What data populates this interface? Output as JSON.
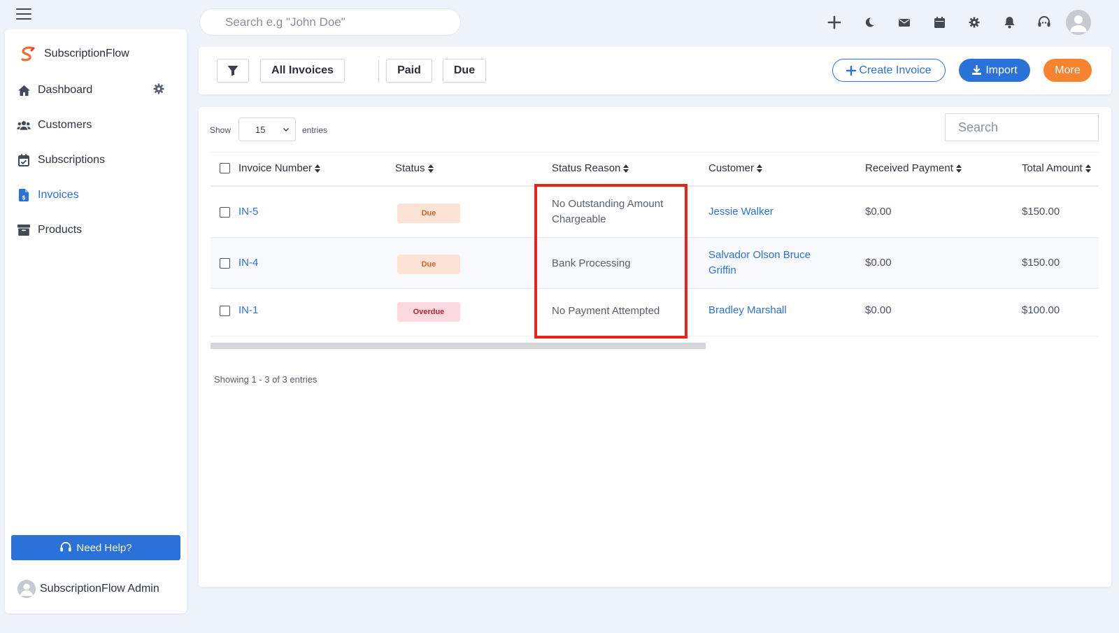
{
  "brand": {
    "name": "SubscriptionFlow"
  },
  "sidebar": {
    "items": [
      {
        "label": "Dashboard",
        "icon": "home-icon",
        "active": false
      },
      {
        "label": "Customers",
        "icon": "users-icon",
        "active": false
      },
      {
        "label": "Subscriptions",
        "icon": "calendar-check-icon",
        "active": false
      },
      {
        "label": "Invoices",
        "icon": "invoice-icon",
        "active": true
      },
      {
        "label": "Products",
        "icon": "archive-icon",
        "active": false
      }
    ],
    "help_label": "Need Help?",
    "admin_name": "SubscriptionFlow Admin"
  },
  "topbar": {
    "search_placeholder": "Search e.g \"John Doe\"",
    "icons": [
      "plus-icon",
      "moon-icon",
      "mail-icon",
      "calendar-icon",
      "gear-icon",
      "bell-icon",
      "headset-icon"
    ]
  },
  "toolbar": {
    "all_invoices": "All Invoices",
    "paid": "Paid",
    "due": "Due",
    "create_invoice": "Create Invoice",
    "import": "Import",
    "more": "More"
  },
  "table_controls": {
    "show_label": "Show",
    "entries_value": "15",
    "entries_label": "entries",
    "search_placeholder": "Search"
  },
  "table": {
    "columns": [
      "Invoice Number",
      "Status",
      "Status Reason",
      "Customer",
      "Received Payment",
      "Total Amount"
    ],
    "rows": [
      {
        "invoice": "IN-5",
        "status": "Due",
        "reason_line1": "No Outstanding Amount",
        "reason_line2": "Chargeable",
        "customer_line1": "Jessie Walker",
        "customer_line2": "",
        "received": "$0.00",
        "total": "$150.00"
      },
      {
        "invoice": "IN-4",
        "status": "Due",
        "reason_line1": "Bank Processing",
        "reason_line2": "",
        "customer_line1": "Salvador Olson Bruce",
        "customer_line2": "Griffin",
        "received": "$0.00",
        "total": "$150.00"
      },
      {
        "invoice": "IN-1",
        "status": "Overdue",
        "reason_line1": "No Payment Attempted",
        "reason_line2": "",
        "customer_line1": "Bradley Marshall",
        "customer_line2": "",
        "received": "$0.00",
        "total": "$100.00"
      }
    ]
  },
  "footer": {
    "showing": "Showing 1 - 3 of 3 entries"
  },
  "colors": {
    "accent": "#2a72d9",
    "orange": "#f58330",
    "highlight": "#e8231b"
  }
}
